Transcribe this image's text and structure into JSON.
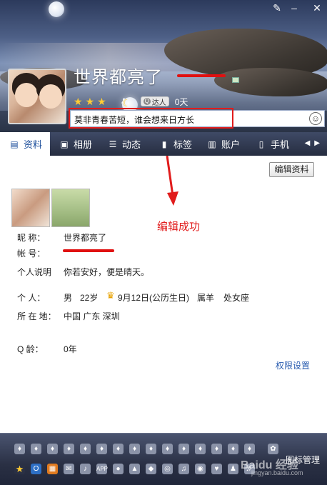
{
  "profile": {
    "nickname": "世界都亮了",
    "days": "0天",
    "talent_badge": "达人",
    "signature": "莫非青春苦短，谁会想来日方长"
  },
  "tabs": [
    {
      "label": "资料",
      "icon": "id-card-icon"
    },
    {
      "label": "相册",
      "icon": "photo-icon"
    },
    {
      "label": "动态",
      "icon": "list-icon"
    },
    {
      "label": "标签",
      "icon": "bookmark-icon"
    },
    {
      "label": "账户",
      "icon": "briefcase-icon"
    },
    {
      "label": "手机",
      "icon": "phone-icon"
    }
  ],
  "content": {
    "edit_button": "编辑资料",
    "annotation": "编辑成功",
    "fields": {
      "nickname_label": "昵    称：",
      "nickname_value": "世界都亮了",
      "account_label": "帐    号：",
      "bio_label": "个人说明",
      "bio_value": "你若安好，便是晴天。",
      "personal_label": "个    人：",
      "gender": "男",
      "age": "22岁",
      "birthday": "9月12日(公历生日)",
      "zodiac": "属羊",
      "constellation": "处女座",
      "location_label": "所 在 地：",
      "location_value": "中国 广东 深圳",
      "qage_label": "Q    龄：",
      "qage_value": "0年"
    },
    "permission_link": "权限设置"
  },
  "bottom": {
    "icon_manage": "图标管理",
    "watermark": "Baidu 经验",
    "watermark_url": "jingyan.baidu.com"
  },
  "colors": {
    "accent_red": "#e11c1c",
    "link_blue": "#2a5db0",
    "tab_active": "#1a4c9a"
  }
}
